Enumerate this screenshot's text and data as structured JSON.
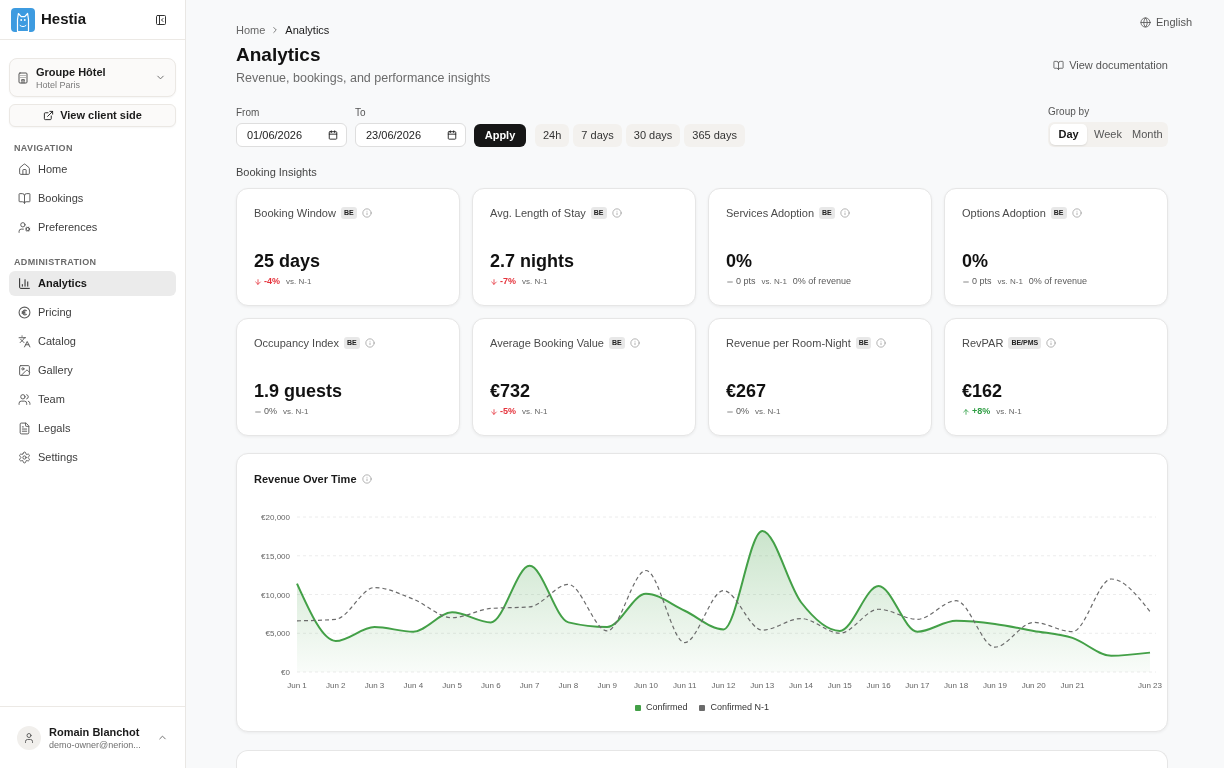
{
  "sidebar": {
    "brand": "Hestia",
    "property_selector": {
      "group": "Groupe Hôtel",
      "hotel": "Hotel Paris"
    },
    "client_side_button": "View client side",
    "sections": [
      {
        "title": "NAVIGATION",
        "items": [
          {
            "label": "Home",
            "selected": false
          },
          {
            "label": "Bookings",
            "selected": false
          },
          {
            "label": "Preferences",
            "selected": false
          }
        ]
      },
      {
        "title": "ADMINISTRATION",
        "items": [
          {
            "label": "Analytics",
            "selected": true
          },
          {
            "label": "Pricing",
            "selected": false
          },
          {
            "label": "Catalog",
            "selected": false
          },
          {
            "label": "Gallery",
            "selected": false
          },
          {
            "label": "Team",
            "selected": false
          },
          {
            "label": "Legals",
            "selected": false
          },
          {
            "label": "Settings",
            "selected": false
          }
        ]
      }
    ],
    "user": {
      "name": "Romain Blanchot",
      "email": "demo-owner@nerion..."
    }
  },
  "language": "English",
  "breadcrumb": [
    {
      "label": "Home"
    },
    {
      "label": "Analytics"
    }
  ],
  "header": {
    "title": "Analytics",
    "subtitle": "Revenue, bookings, and performance insights",
    "documentation_link": "View documentation"
  },
  "filters": {
    "from": {
      "label": "From",
      "value": "01/06/2026"
    },
    "to": {
      "label": "To",
      "value": "23/06/2026"
    },
    "apply_button": "Apply",
    "presets": [
      {
        "label": "24h",
        "selected": false
      },
      {
        "label": "7 days",
        "selected": false
      },
      {
        "label": "30 days",
        "selected": false
      },
      {
        "label": "365 days",
        "selected": false
      }
    ],
    "group_by": {
      "label": "Group by",
      "options": [
        {
          "label": "Day",
          "selected": true
        },
        {
          "label": "Week",
          "selected": false
        },
        {
          "label": "Month",
          "selected": false
        }
      ]
    }
  },
  "booking_insights": {
    "title": "Booking Insights",
    "cards": [
      {
        "title": "Booking Window",
        "badge": "BE",
        "value": "25 days",
        "kind": "down",
        "delta": "-4%",
        "comparison": "vs. N-1"
      },
      {
        "title": "Avg. Length of Stay",
        "badge": "BE",
        "value": "2.7 nights",
        "kind": "down",
        "delta": "-7%",
        "comparison": "vs. N-1"
      },
      {
        "title": "Services Adoption",
        "badge": "BE",
        "value": "0%",
        "kind": "flat",
        "delta": "0 pts",
        "comparison": "vs. N-1",
        "note": "0% of revenue"
      },
      {
        "title": "Options Adoption",
        "badge": "BE",
        "value": "0%",
        "kind": "flat",
        "delta": "0 pts",
        "comparison": "vs. N-1",
        "note": "0% of revenue"
      },
      {
        "title": "Occupancy Index",
        "badge": "BE",
        "value": "1.9 guests",
        "kind": "flat",
        "delta": "0%",
        "comparison": "vs. N-1"
      },
      {
        "title": "Average Booking Value",
        "badge": "BE",
        "value": "€732",
        "kind": "down",
        "delta": "-5%",
        "comparison": "vs. N-1"
      },
      {
        "title": "Revenue per Room-Night",
        "badge": "BE",
        "value": "€267",
        "kind": "flat",
        "delta": "0%",
        "comparison": "vs. N-1"
      },
      {
        "title": "RevPAR",
        "badge": "BE/PMS",
        "value": "€162",
        "kind": "up",
        "delta": "+8%",
        "comparison": "vs. N-1"
      }
    ]
  },
  "revenue_chart": {
    "chart_data": {
      "type": "area",
      "title": "Revenue Over Time",
      "grid": true,
      "categories": [
        "Jun 1",
        "Jun 2",
        "Jun 3",
        "Jun 4",
        "Jun 5",
        "Jun 6",
        "Jun 7",
        "Jun 8",
        "Jun 9",
        "Jun 10",
        "Jun 11",
        "Jun 12",
        "Jun 13",
        "Jun 14",
        "Jun 15",
        "Jun 16",
        "Jun 17",
        "Jun 18",
        "Jun 19",
        "Jun 20",
        "Jun 21",
        null,
        "Jun 23"
      ],
      "ylim": [
        0,
        20000
      ],
      "yticks": [
        {
          "value": 0,
          "label": "€0"
        },
        {
          "value": 5000,
          "label": "€5,000"
        },
        {
          "value": 10000,
          "label": "€10,000"
        },
        {
          "value": 15000,
          "label": "€15,000"
        },
        {
          "value": 20000,
          "label": "€20,000"
        }
      ],
      "series": [
        {
          "name": "Confirmed",
          "type": "area",
          "line_style": "solid",
          "color": "#43a047",
          "values": [
            11400,
            4000,
            5800,
            5200,
            7700,
            6400,
            13700,
            6400,
            5800,
            10100,
            7900,
            5500,
            18200,
            9000,
            5300,
            11100,
            5200,
            6600,
            6200,
            5300,
            4400,
            2100,
            2500
          ]
        },
        {
          "name": "Confirmed N-1",
          "type": "line",
          "line_style": "dashed",
          "color": "#6b6b6b",
          "values": [
            6600,
            6800,
            10900,
            9400,
            7000,
            8200,
            8400,
            11300,
            5300,
            13100,
            3800,
            10500,
            5400,
            6900,
            5000,
            8100,
            6800,
            9200,
            3200,
            6400,
            5200,
            12000,
            7800
          ]
        }
      ]
    }
  }
}
